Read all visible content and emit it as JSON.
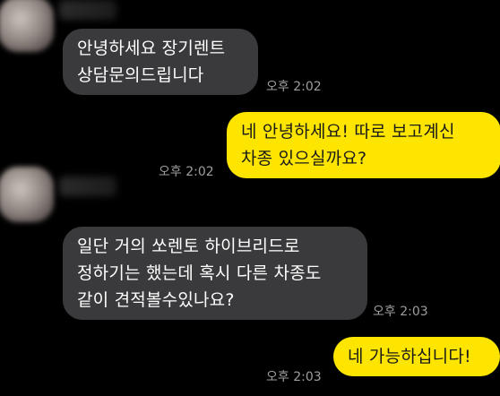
{
  "messages": [
    {
      "side": "in",
      "lines": [
        "안녕하세요 장기렌트",
        "상담문의드립니다"
      ],
      "time": "오후 2:02"
    },
    {
      "side": "out",
      "lines": [
        "네 안녕하세요! 따로 보고계신",
        "차종 있으실까요?"
      ],
      "time": "오후 2:02"
    },
    {
      "side": "in",
      "lines": [
        "일단 거의 쏘렌토 하이브리드로",
        "정하기는 했는데 혹시 다른 차종도",
        "같이 견적볼수있나요?"
      ],
      "time": "오후 2:03"
    },
    {
      "side": "out",
      "lines": [
        "네 가능하십니다!"
      ],
      "time": "오후 2:03"
    }
  ]
}
